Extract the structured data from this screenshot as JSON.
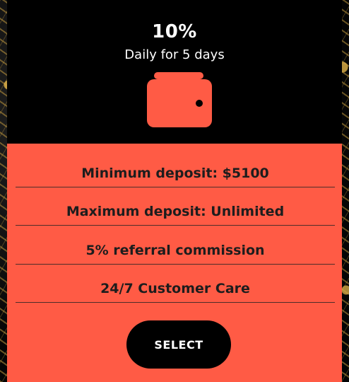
{
  "plan": {
    "rate": "10%",
    "duration": "Daily for 5 days",
    "features": [
      "Minimum deposit: $5100",
      "Maximum deposit: Unlimited",
      "5% referral commission",
      "24/7 Customer Care"
    ],
    "select_label": "SELECT"
  },
  "icons": {
    "wallet": "wallet-icon"
  },
  "colors": {
    "accent": "#ff5b45",
    "header_bg": "#000000",
    "button_bg": "#000000",
    "text_light": "#ffffff",
    "text_dark": "#1d1d1d"
  }
}
